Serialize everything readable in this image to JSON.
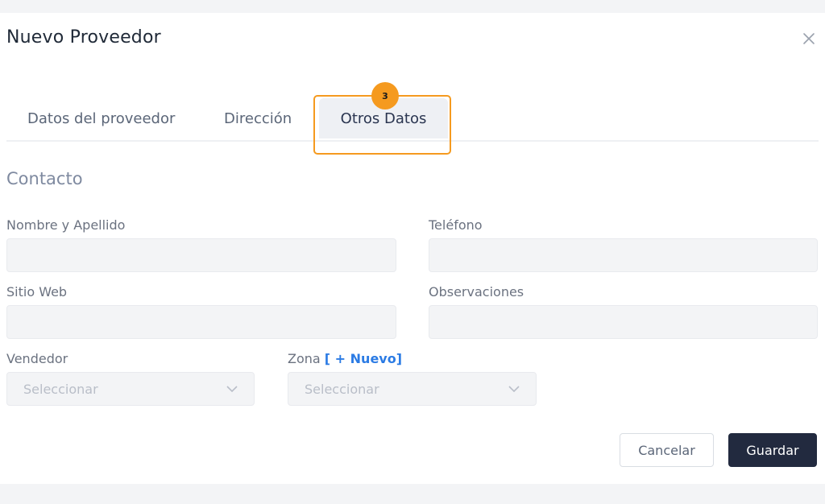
{
  "modal": {
    "title": "Nuevo Proveedor",
    "close_icon": "close-icon"
  },
  "tabs": [
    {
      "label": "Datos del proveedor",
      "active": false
    },
    {
      "label": "Dirección",
      "active": false
    },
    {
      "label": "Otros Datos",
      "active": true
    }
  ],
  "step_badge": "3",
  "colors": {
    "highlight": "#f59a1f",
    "primary_button": "#222a3f",
    "link": "#2b7be4"
  },
  "section": {
    "title": "Contacto"
  },
  "fields": {
    "nombre": {
      "label": "Nombre y Apellido",
      "value": "",
      "placeholder": ""
    },
    "telefono": {
      "label": "Teléfono",
      "value": "",
      "placeholder": ""
    },
    "sitio_web": {
      "label": "Sitio Web",
      "value": "",
      "placeholder": ""
    },
    "observaciones": {
      "label": "Observaciones",
      "value": "",
      "placeholder": ""
    },
    "vendedor": {
      "label": "Vendedor",
      "selected": "Seleccionar"
    },
    "zona": {
      "label": "Zona",
      "new_link": "[ + Nuevo]",
      "selected": "Seleccionar"
    }
  },
  "buttons": {
    "cancel": "Cancelar",
    "save": "Guardar"
  }
}
